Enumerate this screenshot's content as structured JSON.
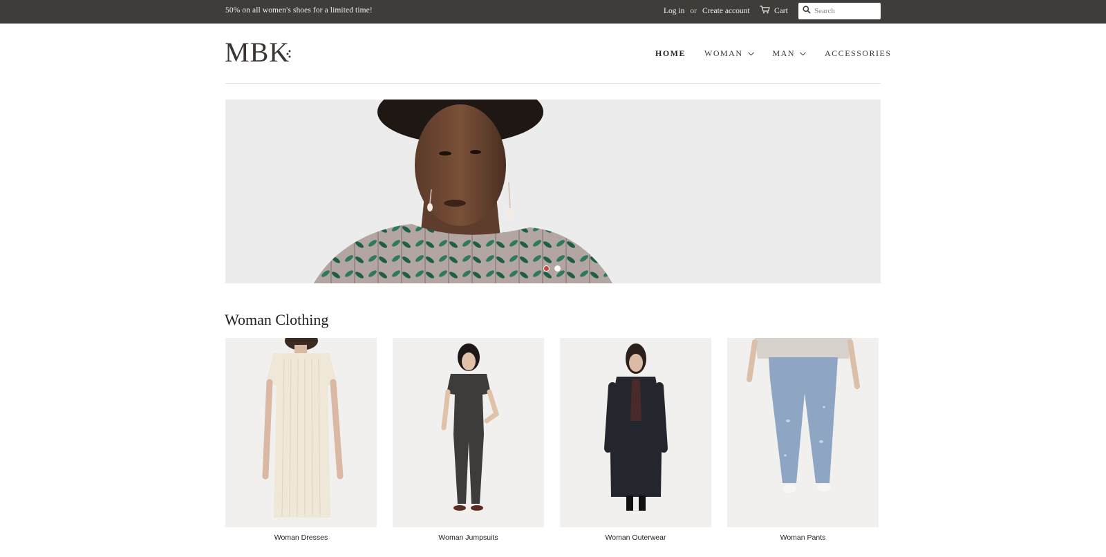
{
  "topbar": {
    "promo": "50% on all women's shoes for a limited time!",
    "login_label": "Log in",
    "or_label": "or",
    "create_account_label": "Create account",
    "cart_label": "Cart",
    "search_placeholder": "Search",
    "search_value": "",
    "icons": {
      "cart": "cart-icon",
      "search": "search-icon"
    },
    "background": "#403c39"
  },
  "header": {
    "logo_text": "MBK",
    "nav": [
      {
        "label": "HOME",
        "active": true,
        "has_dropdown": false
      },
      {
        "label": "WOMAN",
        "active": false,
        "has_dropdown": true
      },
      {
        "label": "MAN",
        "active": false,
        "has_dropdown": true
      },
      {
        "label": "ACCESSORIES",
        "active": false,
        "has_dropdown": false
      }
    ]
  },
  "hero": {
    "slides_count": 2,
    "active_slide": 1,
    "active_dot_color": "#c44a3b"
  },
  "collection": {
    "title": "Woman Clothing",
    "items": [
      {
        "label": "Woman Dresses"
      },
      {
        "label": "Woman Jumpsuits"
      },
      {
        "label": "Woman Outerwear"
      },
      {
        "label": "Woman Pants"
      }
    ]
  }
}
